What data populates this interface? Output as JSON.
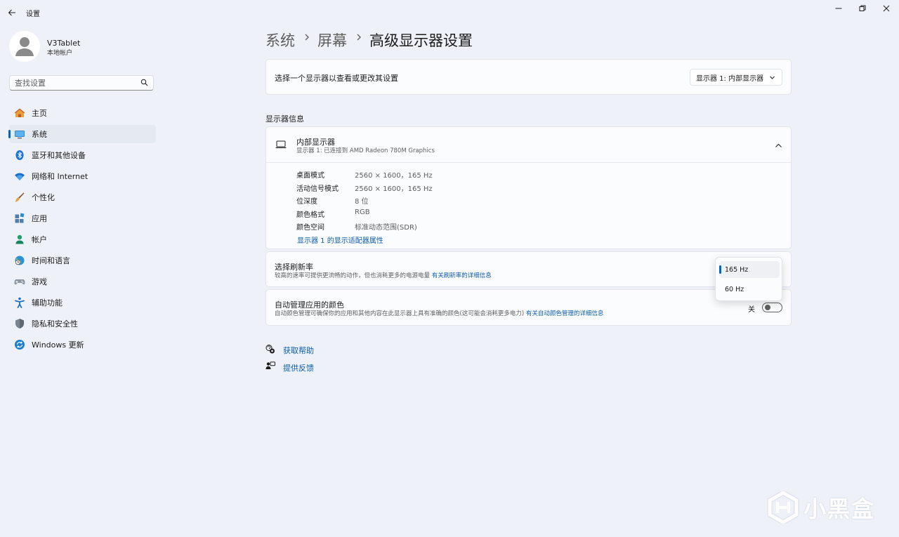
{
  "window": {
    "title": "设置",
    "controls": [
      "minimize",
      "restore",
      "close"
    ]
  },
  "user": {
    "name": "V3Tablet",
    "account_type": "本地帐户"
  },
  "search": {
    "placeholder": "查找设置",
    "value": ""
  },
  "sidebar": {
    "items": [
      {
        "label": "主页",
        "icon": "home-icon",
        "selected": false
      },
      {
        "label": "系统",
        "icon": "system-monitor-icon",
        "selected": true
      },
      {
        "label": "蓝牙和其他设备",
        "icon": "bluetooth-icon",
        "selected": false
      },
      {
        "label": "网络和 Internet",
        "icon": "wifi-icon",
        "selected": false
      },
      {
        "label": "个性化",
        "icon": "brush-icon",
        "selected": false
      },
      {
        "label": "应用",
        "icon": "apps-icon",
        "selected": false
      },
      {
        "label": "帐户",
        "icon": "person-icon",
        "selected": false
      },
      {
        "label": "时间和语言",
        "icon": "globe-clock-icon",
        "selected": false
      },
      {
        "label": "游戏",
        "icon": "gamepad-icon",
        "selected": false
      },
      {
        "label": "辅助功能",
        "icon": "accessibility-icon",
        "selected": false
      },
      {
        "label": "隐私和安全性",
        "icon": "shield-icon",
        "selected": false
      },
      {
        "label": "Windows 更新",
        "icon": "windows-update-icon",
        "selected": false
      }
    ]
  },
  "breadcrumb": [
    "系统",
    "屏幕",
    "高级显示器设置"
  ],
  "display_select": {
    "label": "选择一个显示器以查看或更改其设置",
    "value": "显示器 1: 内部显示器"
  },
  "display_info": {
    "section_title": "显示器信息",
    "device_name": "内部显示器",
    "device_sub": "显示器 1: 已连接到 AMD Radeon 780M Graphics",
    "specs": [
      {
        "key": "桌面模式",
        "value": "2560 × 1600，165 Hz"
      },
      {
        "key": "活动信号模式",
        "value": "2560 × 1600，165 Hz"
      },
      {
        "key": "位深度",
        "value": "8 位"
      },
      {
        "key": "颜色格式",
        "value": "RGB"
      },
      {
        "key": "颜色空间",
        "value": "标准动态范围(SDR)"
      }
    ],
    "adapter_link": "显示器 1 的显示适配器属性"
  },
  "refresh_rate": {
    "title": "选择刷新率",
    "description": "较高的速率可提供更流畅的动作，但也消耗更多的电源电量",
    "link": "有关刷新率的详细信息",
    "options": [
      "165 Hz",
      "60 Hz"
    ],
    "selected": "165 Hz"
  },
  "auto_color": {
    "title": "自动管理应用的颜色",
    "description": "自动颜色管理可确保你的应用和其他内容在此显示器上具有准确的颜色(这可能会消耗更多电力)",
    "link": "有关自动颜色管理的详细信息",
    "state_label": "关",
    "enabled": false
  },
  "footer": {
    "help": "获取帮助",
    "feedback": "提供反馈"
  },
  "watermark": {
    "text": "小黑盒"
  },
  "colors": {
    "accent": "#0067c0",
    "link": "#0b5cad",
    "background": "#eef2f8",
    "card": "#fbfcfd"
  }
}
